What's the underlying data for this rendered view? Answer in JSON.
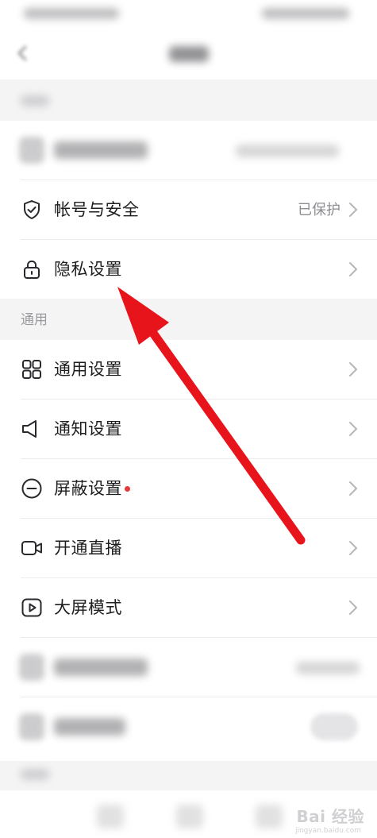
{
  "account_section": {
    "rows": [
      {
        "label": "帐号与安全",
        "value": "已保护",
        "icon": "shield-check-icon"
      },
      {
        "label": "隐私设置",
        "value": "",
        "icon": "lock-icon"
      }
    ]
  },
  "general_section": {
    "label": "通用",
    "rows": [
      {
        "label": "通用设置",
        "icon": "grid-icon"
      },
      {
        "label": "通知设置",
        "icon": "speaker-icon"
      },
      {
        "label": "屏蔽设置",
        "icon": "minus-circle-icon",
        "has_dot": true
      },
      {
        "label": "开通直播",
        "icon": "video-camera-icon"
      },
      {
        "label": "大屏模式",
        "icon": "play-square-icon"
      }
    ]
  },
  "colors": {
    "accent_red": "#e33b3b",
    "arrow_red": "#e8141c",
    "text_primary": "#1e1e20",
    "text_secondary": "#8d8d92",
    "background": "#f4f4f5"
  },
  "watermark": {
    "text": "Bai 经验",
    "subtext": "jingyan.baidu.com"
  }
}
